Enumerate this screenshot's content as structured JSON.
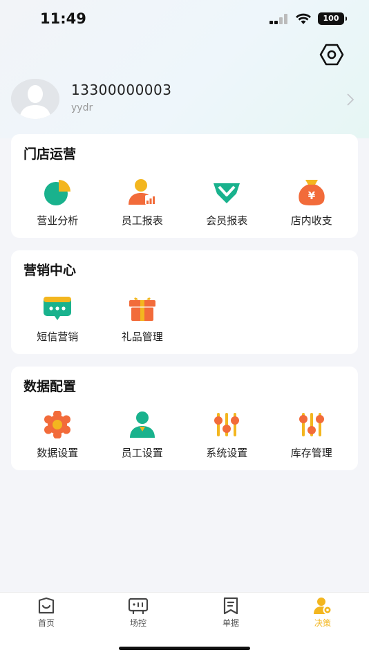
{
  "status_bar": {
    "time": "11:49",
    "battery": "100"
  },
  "profile": {
    "phone": "13300000003",
    "username": "yydr"
  },
  "sections": [
    {
      "title": "门店运营",
      "items": [
        {
          "label": "营业分析",
          "icon": "pie-chart-icon"
        },
        {
          "label": "员工报表",
          "icon": "staff-report-icon"
        },
        {
          "label": "会员报表",
          "icon": "member-report-icon"
        },
        {
          "label": "店内收支",
          "icon": "money-bag-icon"
        }
      ]
    },
    {
      "title": "营销中心",
      "items": [
        {
          "label": "短信营销",
          "icon": "sms-icon"
        },
        {
          "label": "礼品管理",
          "icon": "gift-icon"
        }
      ]
    },
    {
      "title": "数据配置",
      "items": [
        {
          "label": "数据设置",
          "icon": "gear-icon"
        },
        {
          "label": "员工设置",
          "icon": "staff-settings-icon"
        },
        {
          "label": "系统设置",
          "icon": "sliders-icon"
        },
        {
          "label": "库存管理",
          "icon": "inventory-sliders-icon"
        }
      ]
    }
  ],
  "tabbar": [
    {
      "label": "首页",
      "icon": "home-icon"
    },
    {
      "label": "场控",
      "icon": "monitor-icon"
    },
    {
      "label": "单据",
      "icon": "document-icon"
    },
    {
      "label": "决策",
      "icon": "decision-icon",
      "active": true
    }
  ],
  "colors": {
    "green": "#19b28d",
    "orange": "#f26b3a",
    "yellow": "#f3b61f",
    "active_tab": "#f3b61f"
  }
}
